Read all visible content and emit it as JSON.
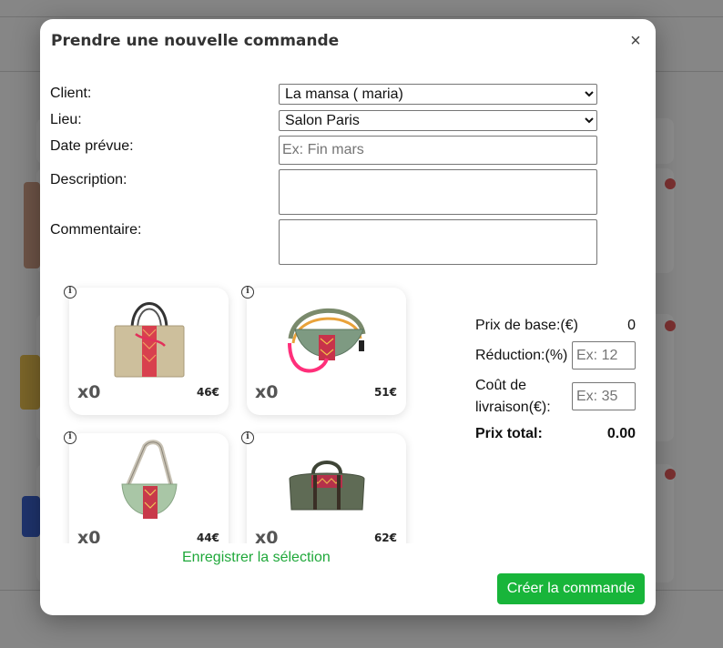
{
  "modal": {
    "title": "Prendre une nouvelle commande",
    "close_glyph": "×"
  },
  "form": {
    "client": {
      "label": "Client:",
      "selected": "La mansa ( maria)",
      "options": [
        "La mansa ( maria)"
      ]
    },
    "lieu": {
      "label": "Lieu:",
      "selected": "Salon Paris",
      "options": [
        "Salon Paris"
      ]
    },
    "date": {
      "label": "Date prévue:",
      "value": "",
      "placeholder": "Ex: Fin mars"
    },
    "description": {
      "label": "Description:",
      "value": ""
    },
    "commentaire": {
      "label": "Commentaire:",
      "value": ""
    }
  },
  "products": [
    {
      "quantity": "x0",
      "price": "46€",
      "icon": "tote-bag-icon",
      "color": "#cdbf9c",
      "accent": "#d8404e"
    },
    {
      "quantity": "x0",
      "price": "51€",
      "icon": "crossbody-bag-icon",
      "color": "#7e9a82",
      "accent": "#c8334a"
    },
    {
      "quantity": "x0",
      "price": "44€",
      "icon": "shoulder-bag-icon",
      "color": "#a9c6a6",
      "accent": "#c83a4a"
    },
    {
      "quantity": "x0",
      "price": "62€",
      "icon": "duffel-bag-icon",
      "color": "#5f6b55",
      "accent": "#b5314a"
    }
  ],
  "save_selection_label": "Enregistrer la sélection",
  "pricing": {
    "base_price_label": "Prix de base:(€)",
    "base_price_value": "0",
    "discount_label": "Réduction:(%)",
    "discount_placeholder": "Ex: 12",
    "delivery_label_line1": "Coût de",
    "delivery_label_line2": "livraison(€):",
    "delivery_placeholder": "Ex: 35",
    "total_label": "Prix total:",
    "total_value": "0.00"
  },
  "create_button_label": "Créer la commande",
  "colors": {
    "accent_green": "#18b53a",
    "link_green": "#1fa83a"
  }
}
